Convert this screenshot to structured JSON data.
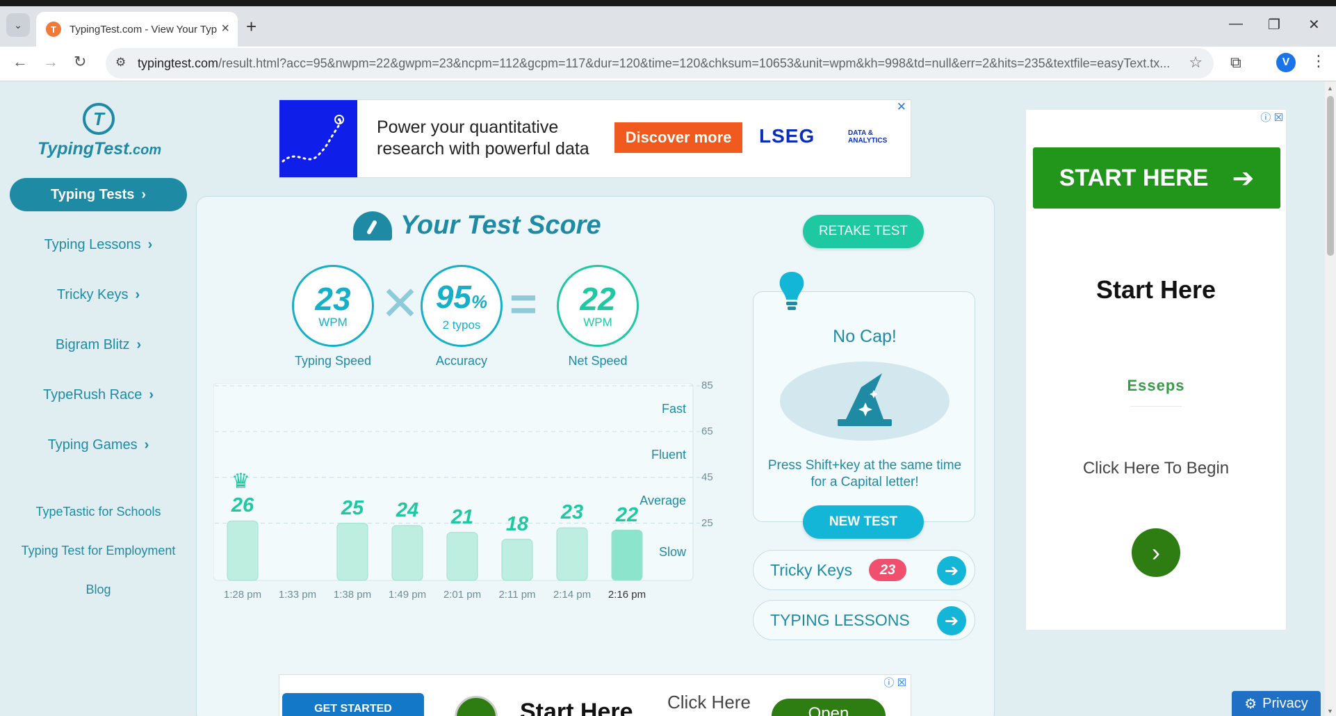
{
  "browser": {
    "tab_title": "TypingTest.com - View Your Typ",
    "url_host": "typingtest.com",
    "url_path": "/result.html?acc=95&nwpm=22&gwpm=23&ncpm=112&gcpm=117&dur=120&time=120&chksum=10653&unit=wpm&kh=998&td=null&err=2&hits=235&textfile=easyText.tx...",
    "avatar_letter": "V"
  },
  "sidebar": {
    "logo_main": "TypingTest",
    "logo_suffix": ".com",
    "logo_letter": "T",
    "items": [
      {
        "label": "Typing Tests",
        "active": true
      },
      {
        "label": "Typing Lessons",
        "active": false
      },
      {
        "label": "Tricky Keys",
        "active": false
      },
      {
        "label": "Bigram Blitz",
        "active": false
      },
      {
        "label": "TypeRush Race",
        "active": false
      },
      {
        "label": "Typing Games",
        "active": false
      }
    ],
    "links": [
      "TypeTastic for Schools",
      "Typing Test for Employment",
      "Blog"
    ]
  },
  "ad_top": {
    "headline_1": "Power your quantitative",
    "headline_2": "research with powerful data",
    "cta": "Discover more",
    "brand": "LSEG",
    "brand_sub_1": "DATA &",
    "brand_sub_2": "ANALYTICS"
  },
  "score": {
    "title": "Your Test Score",
    "retake": "RETAKE TEST",
    "typing_speed": {
      "value": "23",
      "unit": "WPM",
      "label": "Typing Speed"
    },
    "accuracy": {
      "value": "95",
      "pct": "%",
      "unit": "2 typos",
      "label": "Accuracy"
    },
    "net_speed": {
      "value": "22",
      "unit": "WPM",
      "label": "Net Speed"
    }
  },
  "chart_data": {
    "type": "bar",
    "categories": [
      "1:28 pm",
      "1:33 pm",
      "1:38 pm",
      "1:49 pm",
      "2:01 pm",
      "2:11 pm",
      "2:14 pm",
      "2:16 pm"
    ],
    "values": [
      26,
      null,
      25,
      24,
      21,
      18,
      23,
      22
    ],
    "value_labels": [
      "26",
      "",
      "25",
      "24",
      "21",
      "18",
      "23",
      "22"
    ],
    "y_ticks": [
      "85",
      "65",
      "45",
      "25"
    ],
    "bands": [
      "Fast",
      "Fluent",
      "Average",
      "Slow"
    ],
    "ylim": [
      0,
      85
    ],
    "best_index": 0,
    "current_index": 7,
    "bar_color": "#bdeee0",
    "current_bar_color": "#8ce4cc"
  },
  "tip": {
    "title": "No Cap!",
    "text_1": "Press Shift+key at the same time",
    "text_2": "for a Capital letter!",
    "new_test": "NEW TEST"
  },
  "links": {
    "tricky_keys": {
      "label": "Tricky Keys",
      "count": "23"
    },
    "lessons": {
      "label": "TYPING LESSONS"
    }
  },
  "ad_right": {
    "button": "START HERE",
    "heading": "Start Here",
    "brand": "Esseps",
    "text": "Click Here To Begin"
  },
  "ad_bottom": {
    "button": "GET STARTED",
    "heading": "Start Here",
    "text": "Click Here",
    "open": "Open"
  },
  "privacy": "Privacy"
}
